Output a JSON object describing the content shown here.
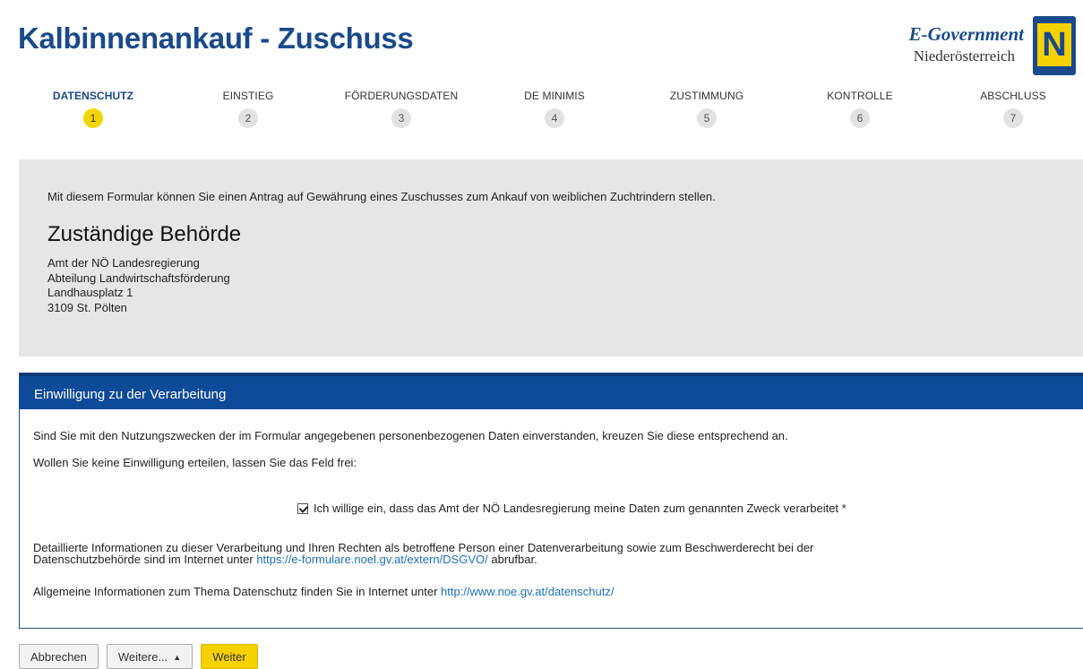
{
  "page": {
    "title": "Kalbinnenankauf - Zuschuss"
  },
  "logo": {
    "line1": "E-Government",
    "line2": "Niederösterreich",
    "mark": "N"
  },
  "steps": [
    {
      "label": "DATENSCHUTZ",
      "num": "1"
    },
    {
      "label": "EINSTIEG",
      "num": "2"
    },
    {
      "label": "FÖRDERUNGSDATEN",
      "num": "3"
    },
    {
      "label": "DE MINIMIS",
      "num": "4"
    },
    {
      "label": "ZUSTIMMUNG",
      "num": "5"
    },
    {
      "label": "KONTROLLE",
      "num": "6"
    },
    {
      "label": "ABSCHLUSS",
      "num": "7"
    }
  ],
  "info": {
    "intro": "Mit diesem Formular können Sie einen Antrag auf Gewährung eines Zuschusses zum Ankauf von weiblichen Zuchtrindern stellen.",
    "heading": "Zuständige Behörde",
    "address": [
      "Amt der NÖ Landesregierung",
      "Abteilung Landwirtschaftsförderung",
      "Landhausplatz 1",
      "3109 St. Pölten"
    ]
  },
  "consent_panel": {
    "header": "Einwilligung zu der Verarbeitung",
    "question": "Sind Sie mit den Nutzungszwecken der im Formular angegebenen personenbezogenen Daten einverstanden, kreuzen Sie diese entsprechend an.",
    "hint": "Wollen Sie keine Einwilligung erteilen, lassen Sie das Feld frei:",
    "checkbox_label": "Ich willige ein, dass das Amt der NÖ Landesregierung meine Daten zum genannten Zweck verarbeitet *",
    "checked": true,
    "detail_text_1": "Detaillierte Informationen zu dieser Verarbeitung und Ihren Rechten als betroffene Person einer Datenverarbeitung sowie zum Beschwerderecht bei der",
    "detail_text_2": "Datenschutzbehörde sind im Internet unter ",
    "detail_link": "https://e-formulare.noel.gv.at/extern/DSGVO/",
    "detail_text_3": " abrufbar.",
    "general_text": "Allgemeine Informationen zum Thema Datenschutz finden Sie in Internet unter ",
    "general_link": "http://www.noe.gv.at/datenschutz/"
  },
  "buttons": {
    "cancel": "Abbrechen",
    "more": "Weitere...",
    "next": "Weiter"
  },
  "colors": {
    "brand_blue": "#1a4a8a",
    "header_blue": "#0d4a97",
    "accent_yellow": "#f5d100",
    "link": "#1e6fb8"
  }
}
